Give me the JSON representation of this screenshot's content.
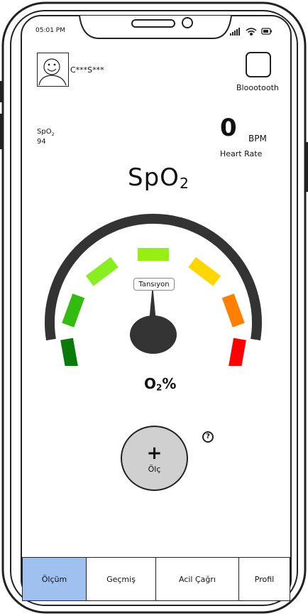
{
  "status_bar": {
    "time": "05:01 PM"
  },
  "user": {
    "name": "C***S***"
  },
  "bluetooth": {
    "label": "Bloootooth"
  },
  "spo2_summary": {
    "label": "SpO",
    "label_sub": "2",
    "value": "94"
  },
  "heart_rate": {
    "value": "0",
    "unit": "BPM",
    "label": "Heart Rate"
  },
  "title": {
    "text": "SpO",
    "sub": "2"
  },
  "gauge": {
    "needle_label": "Tansıyon",
    "segment_colors": [
      "#0a7a0a",
      "#33bb11",
      "#88ee22",
      "#99ee11",
      "#ffd700",
      "#ff8000",
      "#ff0000"
    ],
    "arc_color": "#333333"
  },
  "reading": {
    "prefix": "O",
    "sub": "2",
    "suffix": "%"
  },
  "measure_button": {
    "icon": "plus-icon",
    "label": "Ölç"
  },
  "help": {
    "symbol": "?"
  },
  "tabs": [
    {
      "label": "Ölçüm",
      "active": true
    },
    {
      "label": "Geçmiş",
      "active": false
    },
    {
      "label": "Acil Çağrı",
      "active": false
    },
    {
      "label": "Profil",
      "active": false
    }
  ],
  "colors": {
    "active_tab": "#a0c0f0",
    "button_fill": "#d0d0d0"
  }
}
